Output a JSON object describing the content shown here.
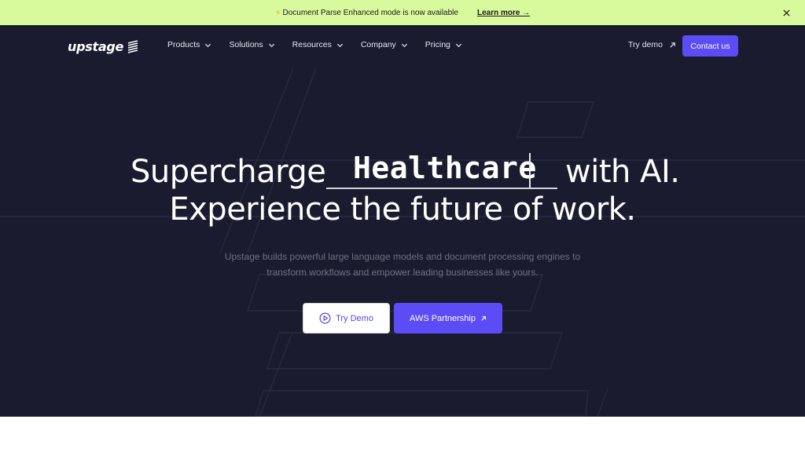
{
  "banner": {
    "message": "Document Parse Enhanced mode is now available",
    "link_label": "Learn more →"
  },
  "nav": {
    "logo_text": "upstage",
    "items": [
      {
        "label": "Products"
      },
      {
        "label": "Solutions"
      },
      {
        "label": "Resources"
      },
      {
        "label": "Company"
      },
      {
        "label": "Pricing"
      }
    ],
    "try_demo_label": "Try demo",
    "contact_label": "Contact us"
  },
  "hero": {
    "headline_prefix": "Supercharge",
    "typed_word": "Healthcare",
    "headline_suffix": "with AI.",
    "headline_line2": "Experience the future of work.",
    "subtext": "Upstage builds powerful large language models and document processing engines to transform workflows and empower leading businesses like yours.",
    "try_demo_button": "Try Demo",
    "aws_button": "AWS Partnership"
  },
  "colors": {
    "banner_bg": "#d9f99d",
    "hero_bg": "#1a1b2e",
    "accent": "#5b4cf5"
  },
  "icons": [
    "lightning-icon",
    "close-icon",
    "chevron-down-icon",
    "arrow-up-right-icon",
    "play-circle-icon",
    "logo-mark-icon"
  ]
}
